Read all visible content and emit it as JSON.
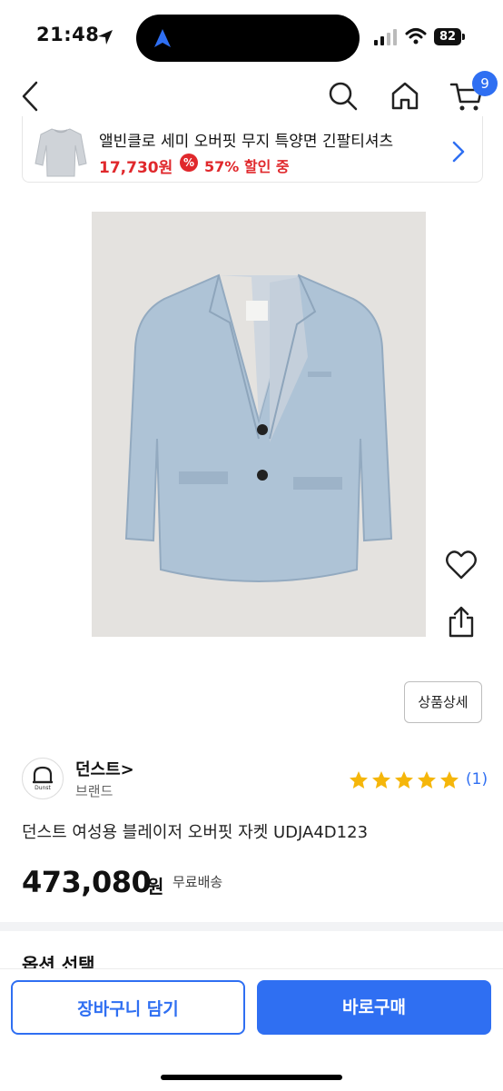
{
  "status": {
    "time": "21:48",
    "battery": "82"
  },
  "nav": {
    "cart_badge": "9"
  },
  "promo": {
    "title": "앨빈클로 세미 오버핏 무지 특양면 긴팔티셔츠",
    "price": "17,730원",
    "percent_icon": "%",
    "discount": "57% 할인 중"
  },
  "product": {
    "detail_button": "상품상세",
    "brand_name": "던스트>",
    "brand_label": "브랜드",
    "brand_logo_text": "Dunst",
    "rating": 5,
    "rating_count": "(1)",
    "name": "던스트 여성용 블레이저 오버핏 자켓 UDJA4D123",
    "price": "473,080",
    "price_unit": "원",
    "shipping": "무료배송"
  },
  "options": {
    "label": "옵션 선택"
  },
  "actions": {
    "cart_label": "장바구니 담기",
    "buy_label": "바로구매"
  },
  "colors": {
    "accent": "#2f6ff2",
    "sale": "#e0282c",
    "star": "#f5b60a"
  }
}
